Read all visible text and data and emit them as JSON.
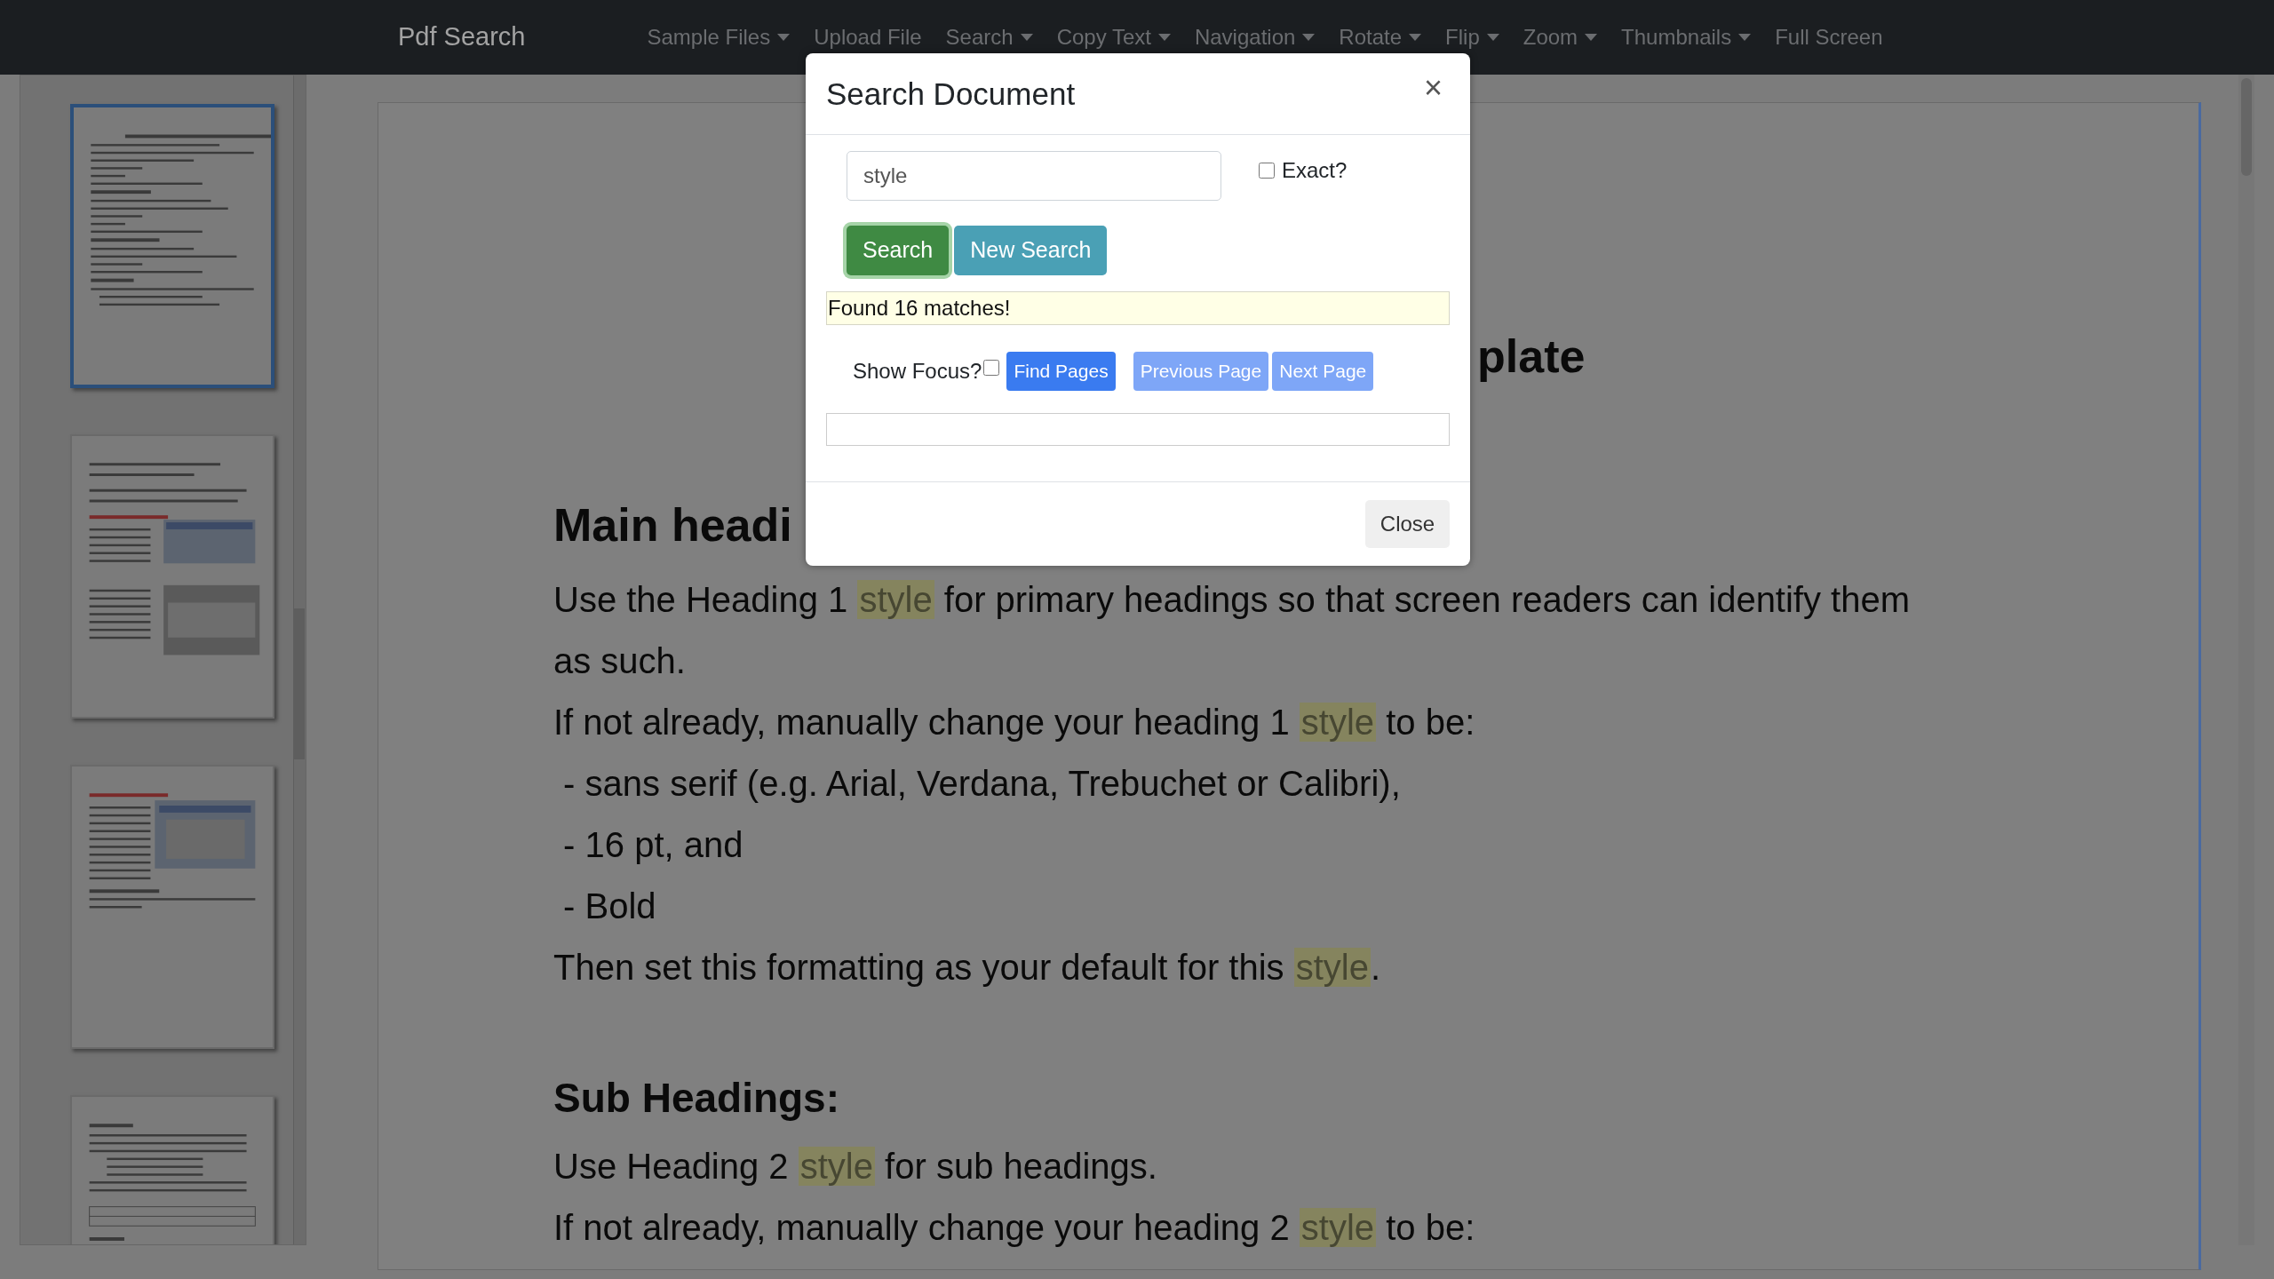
{
  "navbar": {
    "brand": "Pdf Search",
    "items": [
      {
        "label": "Sample Files",
        "dropdown": true
      },
      {
        "label": "Upload File",
        "dropdown": false
      },
      {
        "label": "Search",
        "dropdown": true
      },
      {
        "label": "Copy Text",
        "dropdown": true
      },
      {
        "label": "Navigation",
        "dropdown": true
      },
      {
        "label": "Rotate",
        "dropdown": true
      },
      {
        "label": "Flip",
        "dropdown": true
      },
      {
        "label": "Zoom",
        "dropdown": true
      },
      {
        "label": "Thumbnails",
        "dropdown": true
      },
      {
        "label": "Full Screen",
        "dropdown": false
      }
    ]
  },
  "thumbnails": [
    {
      "selected": true
    },
    {
      "selected": false
    },
    {
      "selected": false
    },
    {
      "selected": false
    }
  ],
  "document": {
    "title": "plate",
    "lines": [
      {
        "kind": "heading1",
        "segments": [
          {
            "text": "Main headi",
            "highlighted": false
          }
        ]
      },
      {
        "kind": "text",
        "segments": [
          {
            "text": "Use the Heading 1 ",
            "highlighted": false
          },
          {
            "text": "style",
            "highlighted": true
          },
          {
            "text": " for primary headings so that screen readers can identify them",
            "highlighted": false
          }
        ]
      },
      {
        "kind": "text",
        "segments": [
          {
            "text": "as such.",
            "highlighted": false
          }
        ]
      },
      {
        "kind": "text",
        "segments": [
          {
            "text": "If not already, manually change your heading 1 ",
            "highlighted": false
          },
          {
            "text": "style",
            "highlighted": true
          },
          {
            "text": " to be:",
            "highlighted": false
          }
        ]
      },
      {
        "kind": "text",
        "segments": [
          {
            "text": " - sans serif (e.g. Arial, Verdana, Trebuchet or Calibri),",
            "highlighted": false
          }
        ]
      },
      {
        "kind": "text",
        "segments": [
          {
            "text": " - 16 pt, and",
            "highlighted": false
          }
        ]
      },
      {
        "kind": "text",
        "segments": [
          {
            "text": " - Bold",
            "highlighted": false
          }
        ]
      },
      {
        "kind": "text",
        "segments": [
          {
            "text": "Then set this formatting as your default for this ",
            "highlighted": false
          },
          {
            "text": "style",
            "highlighted": true
          },
          {
            "text": ".",
            "highlighted": false
          }
        ]
      },
      {
        "kind": "heading2",
        "segments": [
          {
            "text": "Sub Headings:",
            "highlighted": false
          }
        ]
      },
      {
        "kind": "text",
        "segments": [
          {
            "text": "Use Heading 2 ",
            "highlighted": false
          },
          {
            "text": "style",
            "highlighted": true
          },
          {
            "text": " for sub headings.",
            "highlighted": false
          }
        ]
      },
      {
        "kind": "text",
        "segments": [
          {
            "text": "If not already, manually change your heading 2 ",
            "highlighted": false
          },
          {
            "text": "style",
            "highlighted": true
          },
          {
            "text": " to be:",
            "highlighted": false
          }
        ]
      }
    ]
  },
  "dialog": {
    "title": "Search Document",
    "close_glyph": "×",
    "search_field": {
      "value": "style"
    },
    "exact": {
      "label": "Exact?",
      "checked": false
    },
    "buttons": [
      {
        "label": "Search",
        "kind": "success",
        "focused": true
      },
      {
        "label": "New Search",
        "kind": "info",
        "focused": false
      }
    ],
    "message": "Found 16 matches!",
    "show_focus": {
      "label": "Show Focus?",
      "checked": false
    },
    "page_buttons": [
      {
        "label": "Find Pages",
        "disabled": false
      },
      {
        "label": "Previous Page",
        "disabled": true
      },
      {
        "label": "Next Page",
        "disabled": true
      }
    ],
    "footer_button": "Close"
  }
}
